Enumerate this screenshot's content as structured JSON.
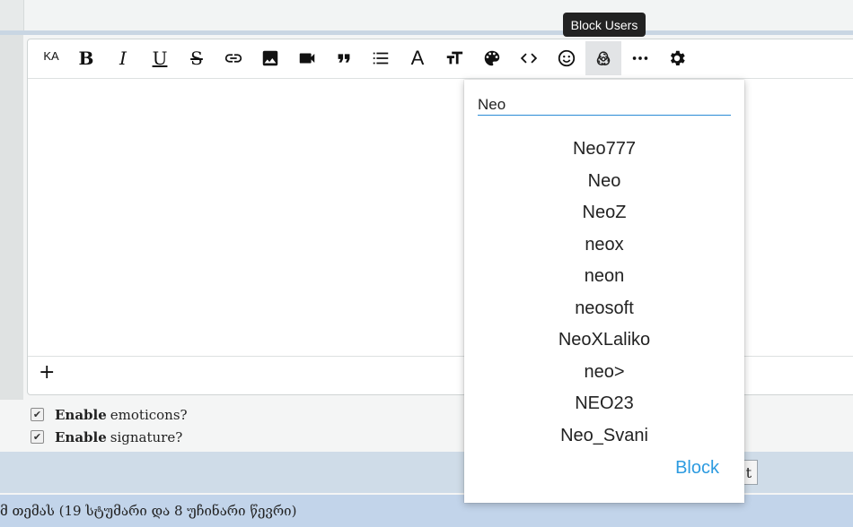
{
  "toolbar": {
    "language_label": "KA",
    "buttons": [
      {
        "name": "language-button",
        "icon": "ka-text"
      },
      {
        "name": "bold-button",
        "icon": "bold-icon"
      },
      {
        "name": "italic-button",
        "icon": "italic-icon"
      },
      {
        "name": "underline-button",
        "icon": "underline-icon"
      },
      {
        "name": "strikethrough-button",
        "icon": "strikethrough-icon"
      },
      {
        "name": "link-button",
        "icon": "link-icon"
      },
      {
        "name": "image-button",
        "icon": "image-icon"
      },
      {
        "name": "video-button",
        "icon": "video-icon"
      },
      {
        "name": "quote-button",
        "icon": "quote-icon"
      },
      {
        "name": "list-button",
        "icon": "list-icon"
      },
      {
        "name": "font-button",
        "icon": "font-icon"
      },
      {
        "name": "text-size-button",
        "icon": "text-size-icon"
      },
      {
        "name": "color-button",
        "icon": "palette-icon"
      },
      {
        "name": "code-button",
        "icon": "code-icon"
      },
      {
        "name": "emoji-button",
        "icon": "smile-icon"
      },
      {
        "name": "block-users-button",
        "icon": "biohazard-icon"
      },
      {
        "name": "more-button",
        "icon": "ellipsis-icon"
      },
      {
        "name": "settings-button",
        "icon": "gear-icon"
      }
    ],
    "bold_label": "B",
    "italic_label": "I",
    "underline_label": "U",
    "strike_label": "S",
    "font_label": "A"
  },
  "tooltip": {
    "text": "Block Users"
  },
  "editor": {
    "add_label": "+"
  },
  "options": {
    "emoticons": {
      "bold": "Enable",
      "text": "emoticons?",
      "checked": true
    },
    "signature": {
      "bold": "Enable",
      "text": "signature?",
      "checked": true
    }
  },
  "submit": {
    "label": "t"
  },
  "status": {
    "text": "მ თემას (19 სტუმარი და 8 უჩინარი წევრი)"
  },
  "block_dropdown": {
    "search_value": "Neo",
    "users": [
      "Neo777",
      "Neo",
      "NeoZ",
      "neox",
      "neon",
      "neosoft",
      "NeoXLaliko",
      "neo>",
      "NEO23",
      "Neo_Svani"
    ],
    "action_label": "Block",
    "accent_color": "#2d9be0"
  }
}
